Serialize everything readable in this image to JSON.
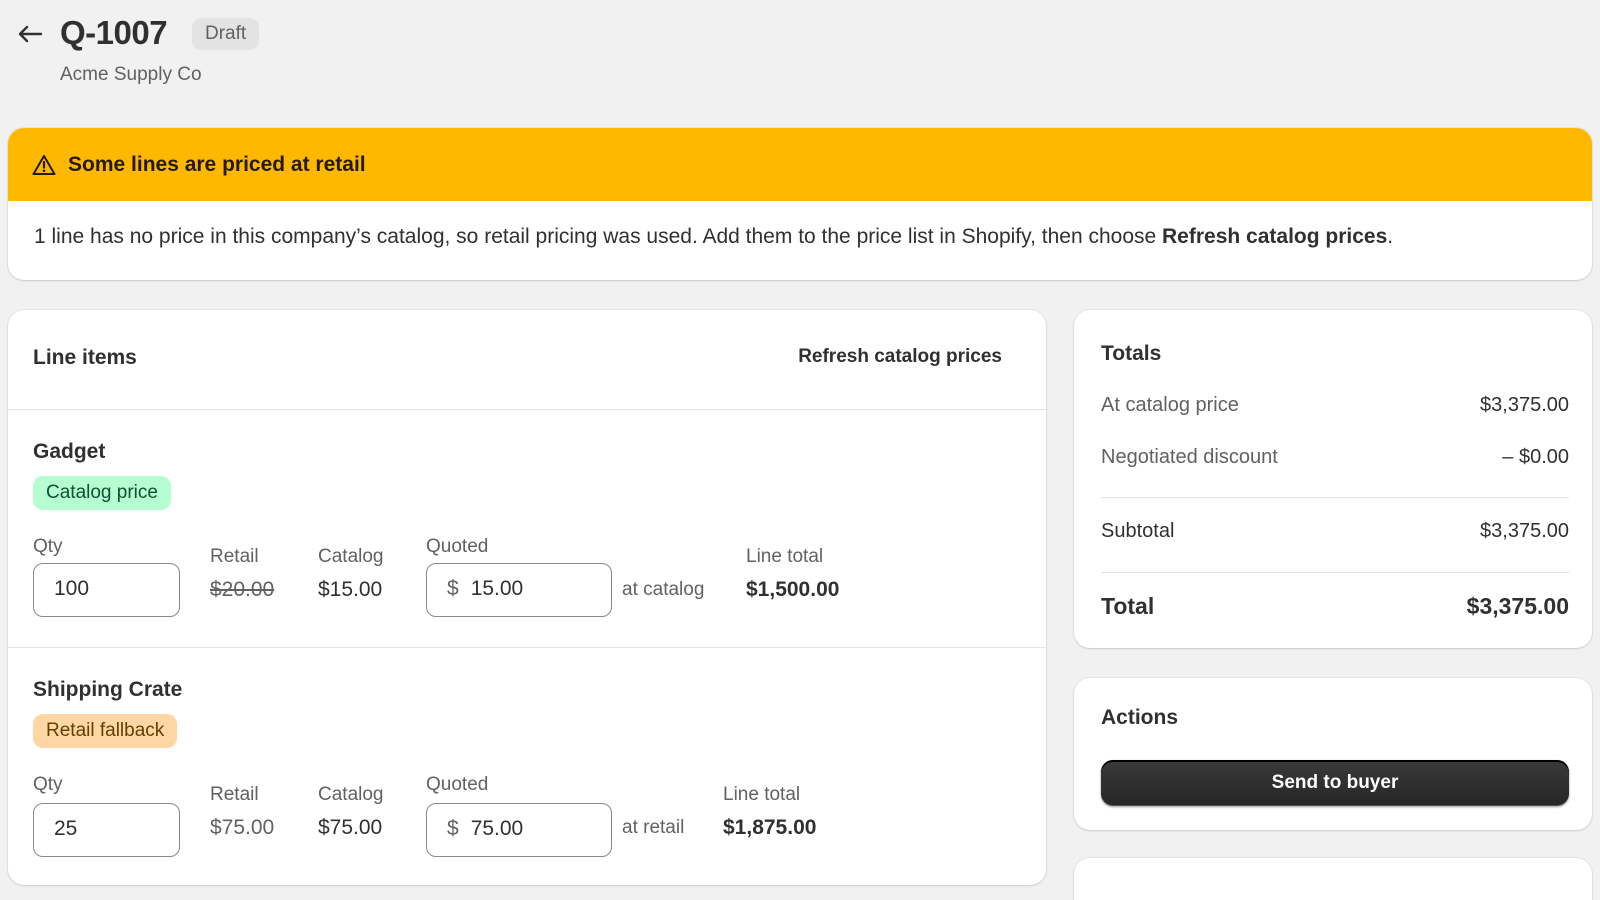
{
  "header": {
    "title": "Q-1007",
    "status_badge": "Draft",
    "subtitle": "Acme Supply Co"
  },
  "banner": {
    "title": "Some lines are priced at retail",
    "body_prefix": "1 line has no price in this company’s catalog, so retail pricing was used. Add them to the price list in Shopify, then choose ",
    "body_bold": "Refresh catalog prices",
    "body_suffix": ".",
    "color": "#ffb800"
  },
  "line_items": {
    "title": "Line items",
    "refresh_label": "Refresh catalog prices",
    "labels": {
      "qty": "Qty",
      "retail": "Retail",
      "catalog": "Catalog",
      "quoted": "Quoted",
      "line_total": "Line total",
      "currency": "$"
    },
    "rows": [
      {
        "name": "Gadget",
        "badge": "Catalog price",
        "qty": "100",
        "retail": "$20.00",
        "catalog": "$15.00",
        "quoted": "15.00",
        "note": "at catalog",
        "line_total": "$1,500.00"
      },
      {
        "name": "Shipping Crate",
        "badge": "Retail fallback",
        "qty": "25",
        "retail": "$75.00",
        "catalog": "$75.00",
        "quoted": "75.00",
        "note": "at retail",
        "line_total": "$1,875.00"
      }
    ]
  },
  "totals": {
    "title": "Totals",
    "at_catalog_label": "At catalog price",
    "at_catalog_value": "$3,375.00",
    "discount_label": "Negotiated discount",
    "discount_value": "– $0.00",
    "subtotal_label": "Subtotal",
    "subtotal_value": "$3,375.00",
    "total_label": "Total",
    "total_value": "$3,375.00"
  },
  "actions": {
    "title": "Actions",
    "send_label": "Send to buyer"
  }
}
